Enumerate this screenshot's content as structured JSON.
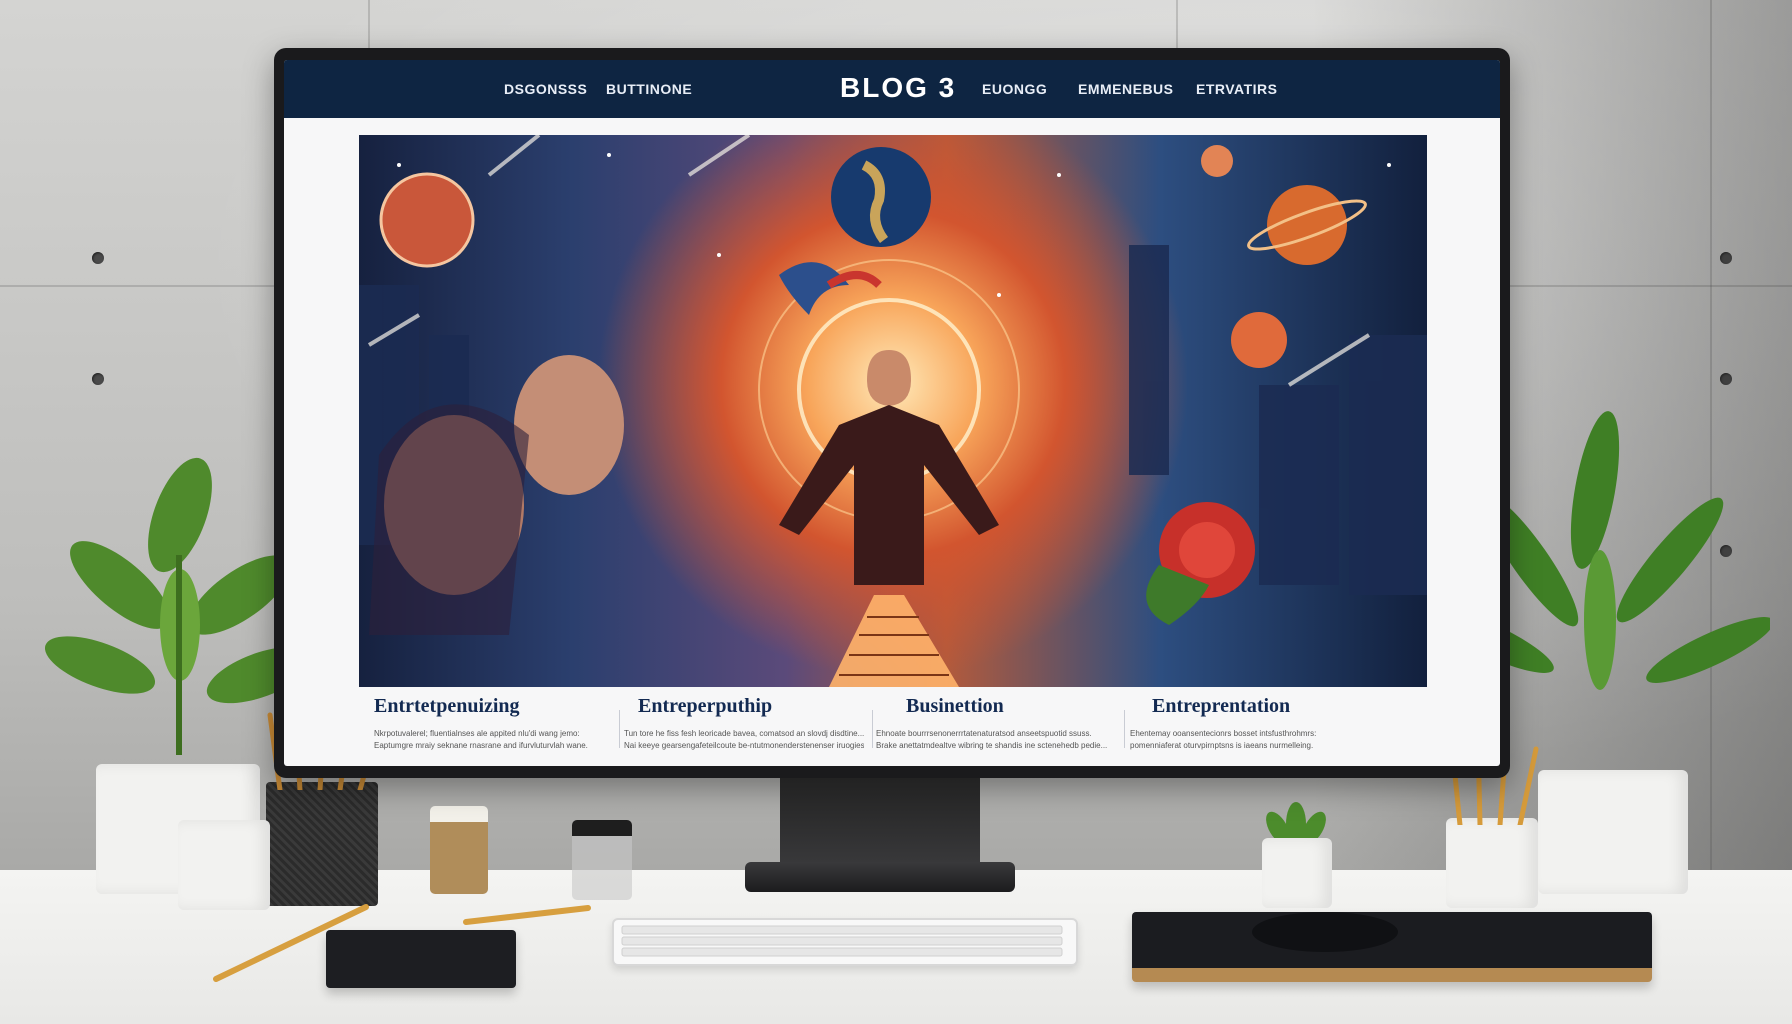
{
  "nav": {
    "logo": "BLOG 3",
    "items_left": [
      "DSGONSSS",
      "BUTTINONE"
    ],
    "items_right": [
      "EUONGG",
      "EMMENEBUS",
      "ETRVATIRS"
    ]
  },
  "articles": [
    {
      "title": "Entrtetpenuizing",
      "lines": [
        "Nkrpotuvalerel; fluentialnses ale appited nlu'di wang jemo:",
        "Eaptumgre mraiy seknane rnasrane and ifurvluturvlah wane."
      ]
    },
    {
      "title": "Entreperputhip",
      "lines": [
        "Tun tore he fiss fesh leoricade bavea, comatsod an slovdj disdtine...",
        "Nai keeye gearsengafeteilcoute be-ntutmonenderstenenser iruogies..."
      ]
    },
    {
      "title": "Businettion",
      "lines": [
        "Ehnoate bourrrsenonerrrtatenaturatsod anseetspuotid ssuss.",
        "Brake anettatmdealtve wibring te shandis ine sctenehedb pedie..."
      ]
    },
    {
      "title": "Entreprentation",
      "lines": [
        "Ehentemay ooansentecionrs bosset intsfusthrohmrs:",
        "pomenniaferat oturvpirnptsns is iaeans nurmelleing."
      ]
    }
  ],
  "colors": {
    "nav_bg": "#0e2542",
    "title": "#132a52",
    "accent_glow": "#f8a55a"
  },
  "icons": [
    "plant-left",
    "plant-right",
    "pencil-cup",
    "keyboard",
    "mouse",
    "notebook"
  ]
}
